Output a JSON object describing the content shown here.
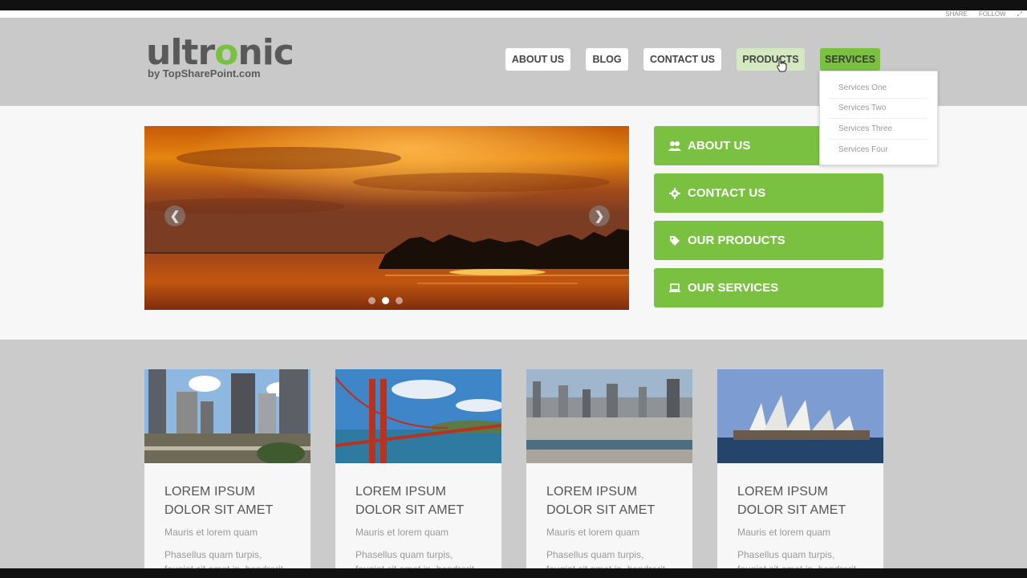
{
  "sp_ribbon": {
    "share": "SHARE",
    "follow": "FOLLOW"
  },
  "logo": {
    "name_part1": "ultr",
    "name_o": "o",
    "name_part2": "nic",
    "tagline": "by TopSharePoint.com"
  },
  "nav": {
    "items": [
      {
        "label": "ABOUT US"
      },
      {
        "label": "BLOG"
      },
      {
        "label": "CONTACT US"
      },
      {
        "label": "PRODUCTS"
      },
      {
        "label": "SERVICES"
      }
    ],
    "services_dropdown": [
      "Services One",
      "Services Two",
      "Services Three",
      "Services Four"
    ]
  },
  "slider": {
    "prev_glyph": "❮",
    "next_glyph": "❯",
    "slide_count": 3,
    "active_slide": 2
  },
  "quick_links": [
    {
      "label": "ABOUT US",
      "icon": "users-icon"
    },
    {
      "label": "CONTACT US",
      "icon": "gear-icon"
    },
    {
      "label": "OUR PRODUCTS",
      "icon": "tag-icon"
    },
    {
      "label": "OUR SERVICES",
      "icon": "laptop-icon"
    }
  ],
  "cards": [
    {
      "title_line1": "LOREM IPSUM",
      "title_line2": "DOLOR SIT AMET",
      "subtitle": "Mauris et lorem quam",
      "text": "Phasellus quam turpis, feugiat sit amet in, hendrerit"
    },
    {
      "title_line1": "LOREM IPSUM",
      "title_line2": "DOLOR SIT AMET",
      "subtitle": "Mauris et lorem quam",
      "text": "Phasellus quam turpis, feugiat sit amet in, hendrerit"
    },
    {
      "title_line1": "LOREM IPSUM",
      "title_line2": "DOLOR SIT AMET",
      "subtitle": "Mauris et lorem quam",
      "text": "Phasellus quam turpis, feugiat sit amet in, hendrerit"
    },
    {
      "title_line1": "LOREM IPSUM",
      "title_line2": "DOLOR SIT AMET",
      "subtitle": "Mauris et lorem quam",
      "text": "Phasellus quam turpis, feugiat sit amet in, hendrerit"
    }
  ],
  "colors": {
    "accent": "#7ac142",
    "header_bg": "#c9c9c9",
    "content_bg": "#f7f7f7"
  }
}
